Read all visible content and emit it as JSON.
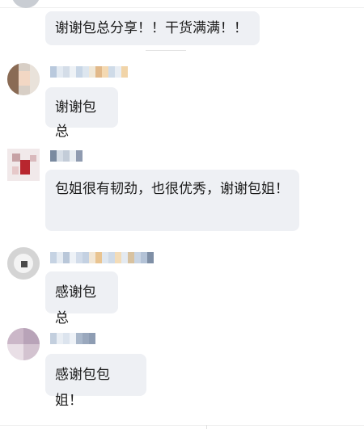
{
  "chat": {
    "messages": [
      {
        "sender": "",
        "text": "谢谢包总分享！！干货满满！！"
      },
      {
        "sender": "",
        "text": "谢谢包总"
      },
      {
        "sender": "",
        "text": "包姐很有韧劲，也很优秀，谢谢包姐！"
      },
      {
        "sender": "",
        "text": "感谢包总"
      },
      {
        "sender": "",
        "text": "感谢包包姐！"
      }
    ]
  },
  "colors": {
    "bubble_background": "#eef0f4",
    "text": "#1a1a1a",
    "page_background": "#ffffff"
  }
}
